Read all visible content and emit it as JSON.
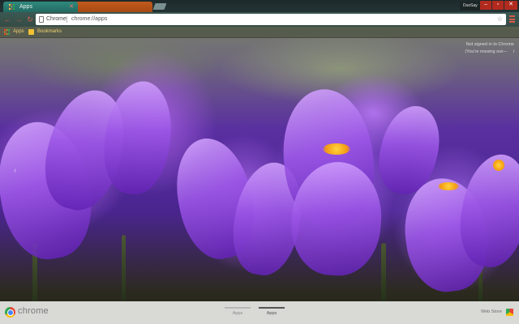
{
  "tabs": [
    {
      "label": "Apps",
      "active": true
    },
    {
      "label": "",
      "active": false
    }
  ],
  "window": {
    "user_label": "DuoSay",
    "min_glyph": "–",
    "max_glyph": "▫",
    "close_glyph": "✕",
    "tab_close_glyph": "✕"
  },
  "toolbar": {
    "back_glyph": "←",
    "forward_glyph": "→",
    "reload_glyph": "↻",
    "omnibox_chip": "Chrome",
    "url": "chrome://apps",
    "star_glyph": "☆"
  },
  "bookmarks_bar": {
    "items": [
      {
        "label": "Apps",
        "icon": "apps-grid-icon"
      },
      {
        "label": "Bookmarks",
        "icon": "folder-icon"
      }
    ]
  },
  "signin_notice": {
    "line1": "Not signed in to Chrome",
    "line2": "(You're missing out—",
    "dismiss_glyph": "i"
  },
  "carousel": {
    "prev_glyph": "‹"
  },
  "bottom_bar": {
    "brand": "chrome",
    "page_tabs": [
      {
        "label": "Apps",
        "active": false
      },
      {
        "label": "Apps",
        "active": true
      }
    ],
    "web_store_label": "Web Store"
  },
  "colors": {
    "active_tab": "#2f8a7e",
    "inactive_tab": "#c25a1c",
    "accent_red": "#d55a4a",
    "bookmark_text": "#f1d070"
  }
}
